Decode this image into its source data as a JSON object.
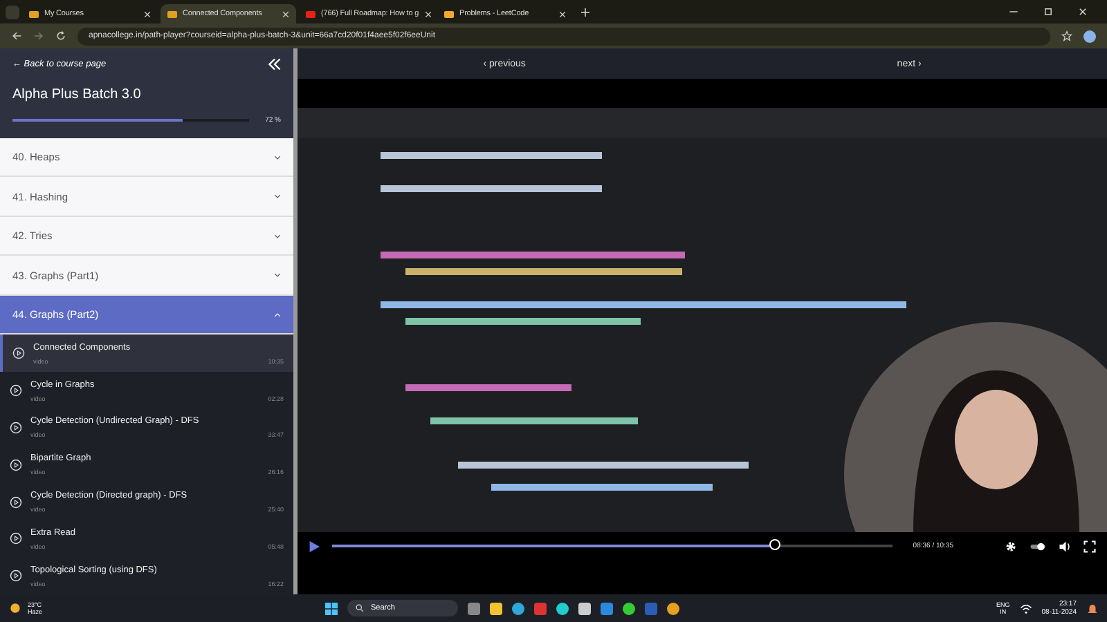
{
  "browser": {
    "tabs": [
      {
        "label": "My Courses",
        "selected": false,
        "kind": "site"
      },
      {
        "label": "Connected Components",
        "selected": true,
        "kind": "site"
      },
      {
        "label": "(766) Full Roadmap: How to g",
        "selected": false,
        "kind": "video"
      },
      {
        "label": "Problems - LeetCode",
        "selected": false,
        "kind": "code"
      }
    ],
    "url": "apnacollege.in/path-player?courseid=alpha-plus-batch-3&unit=66a7cd20f01f4aee5f02f6eeUnit"
  },
  "sidebar": {
    "back_link": "← Back to course page",
    "course_title": "Alpha Plus Batch 3.0",
    "progress": {
      "level": 0.72,
      "reading": "72 %"
    },
    "chapters": [
      {
        "title": "40. Heaps",
        "expanded": false
      },
      {
        "title": "41. Hashing",
        "expanded": false
      },
      {
        "title": "42. Tries",
        "expanded": false
      },
      {
        "title": "43. Graphs (Part1)",
        "expanded": false
      },
      {
        "title": "44. Graphs (Part2)",
        "expanded": true
      }
    ],
    "lessons": [
      {
        "title": "Connected Components",
        "type": "video",
        "duration": "10:35",
        "selected": true
      },
      {
        "title": "Cycle in Graphs",
        "type": "video",
        "duration": "02:28",
        "selected": false
      },
      {
        "title": "Cycle Detection (Undirected Graph) - DFS",
        "type": "video",
        "duration": "33:47",
        "selected": false
      },
      {
        "title": "Bipartite Graph",
        "type": "video",
        "duration": "26:16",
        "selected": false
      },
      {
        "title": "Cycle Detection (Directed graph) - DFS",
        "type": "video",
        "duration": "25:40",
        "selected": false
      },
      {
        "title": "Extra Read",
        "type": "video",
        "duration": "05:48",
        "selected": false
      },
      {
        "title": "Topological Sorting (using DFS)",
        "type": "video",
        "duration": "16:22",
        "selected": false
      }
    ]
  },
  "nav": {
    "previous": "‹ previous",
    "next": "next ›"
  },
  "player": {
    "kind": "picture",
    "playback": {
      "level": 0.79
    },
    "time": "08:36 / 10:35"
  },
  "taskbar": {
    "weather": {
      "temp": "23°C",
      "condition": "Haze"
    },
    "search": "Search",
    "language": [
      "ENG",
      "IN"
    ],
    "time": "23:17",
    "date": "08-11-2024"
  }
}
